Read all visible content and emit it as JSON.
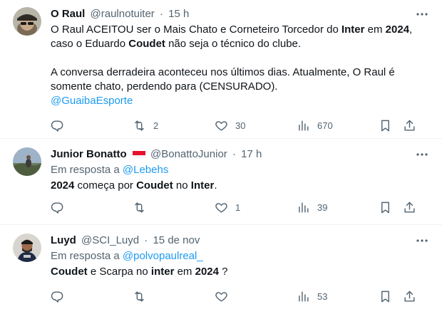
{
  "tweets": [
    {
      "name": "O Raul",
      "handle": "@raulnotuiter",
      "sep": "·",
      "time": "15 h",
      "reply_prefix": "",
      "reply_to": "",
      "p1": [
        {
          "t": "O Raul ACEITOU ser o Mais Chato e Corneteiro Torcedor do ",
          "b": false
        },
        {
          "t": "Inter",
          "b": true
        },
        {
          "t": " em ",
          "b": false
        },
        {
          "t": "2024",
          "b": true
        },
        {
          "t": ",",
          "b": false
        }
      ],
      "p2": [
        {
          "t": "caso o Eduardo ",
          "b": false
        },
        {
          "t": "Coudet",
          "b": true
        },
        {
          "t": " não seja o técnico do clube.",
          "b": false
        }
      ],
      "p3": "A conversa derradeira aconteceu nos últimos dias. Atualmente, O Raul é",
      "p4": "somente chato, perdendo para (CENSURADO).",
      "mention": "@GuaibaEsporte",
      "stats": {
        "replies": "",
        "reposts": "2",
        "likes": "30",
        "views": "670"
      }
    },
    {
      "name": "Junior Bonatto",
      "handle": "@BonattoJunior",
      "sep": "·",
      "time": "17 h",
      "reply_prefix": "Em resposta a ",
      "reply_to": "@Lebehs",
      "line": [
        {
          "t": "2024",
          "b": true
        },
        {
          "t": " começa por ",
          "b": false
        },
        {
          "t": "Coudet",
          "b": true
        },
        {
          "t": " no ",
          "b": false
        },
        {
          "t": "Inter",
          "b": true
        },
        {
          "t": ".",
          "b": false
        }
      ],
      "stats": {
        "replies": "",
        "reposts": "",
        "likes": "1",
        "views": "39"
      }
    },
    {
      "name": "Luyd",
      "handle": "@SCI_Luyd",
      "sep": "·",
      "time": "15 de nov",
      "reply_prefix": "Em resposta a ",
      "reply_to": "@polvopaulreal_",
      "line": [
        {
          "t": "Coudet",
          "b": true
        },
        {
          "t": " e Scarpa no ",
          "b": false
        },
        {
          "t": "inter",
          "b": true
        },
        {
          "t": " em ",
          "b": false
        },
        {
          "t": "2024",
          "b": true
        },
        {
          "t": " ?",
          "b": false
        }
      ],
      "stats": {
        "replies": "",
        "reposts": "",
        "likes": "",
        "views": "53"
      }
    }
  ],
  "icons": {
    "reply": "reply-icon",
    "repost": "repost-icon",
    "like": "like-icon",
    "views": "views-icon",
    "bookmark": "bookmark-icon",
    "share": "share-icon",
    "more": "more-icon"
  },
  "colors": {
    "text": "#0f1419",
    "muted": "#536471",
    "link": "#1d9bf0",
    "border": "#eff3f4"
  }
}
